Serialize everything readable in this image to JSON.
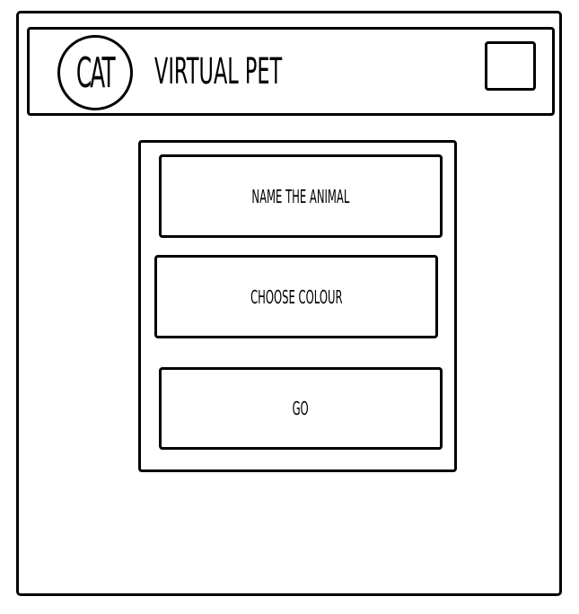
{
  "header": {
    "logo_text": "CAT",
    "title": "VIRTUAL PET"
  },
  "menu": {
    "name_label": "NAME THE ANIMAL",
    "colour_label": "CHOOSE COLOUR",
    "go_label": "GO"
  },
  "colors": {
    "stroke": "#000000",
    "background": "#ffffff"
  }
}
